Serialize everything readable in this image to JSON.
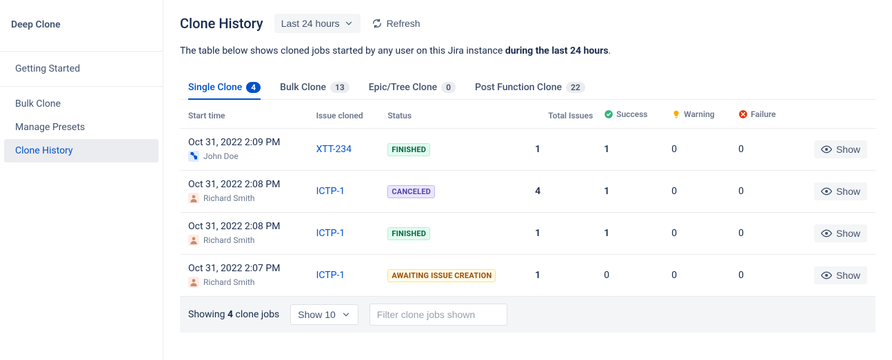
{
  "sidebar": {
    "title": "Deep Clone",
    "sections": [
      {
        "items": [
          {
            "label": "Getting Started"
          }
        ]
      },
      {
        "items": [
          {
            "label": "Bulk Clone"
          },
          {
            "label": "Manage Presets"
          },
          {
            "label": "Clone History",
            "active": true
          }
        ]
      }
    ]
  },
  "header": {
    "title": "Clone History",
    "timeRangeLabel": "Last 24 hours",
    "refreshLabel": "Refresh"
  },
  "description": {
    "prefix": "The table below shows cloned jobs started by any user on this Jira instance ",
    "bold": "during the last 24 hours",
    "suffix": "."
  },
  "tabs": [
    {
      "label": "Single Clone",
      "count": "4",
      "active": true
    },
    {
      "label": "Bulk Clone",
      "count": "13"
    },
    {
      "label": "Epic/Tree Clone",
      "count": "0"
    },
    {
      "label": "Post Function Clone",
      "count": "22"
    }
  ],
  "columns": {
    "startTime": "Start time",
    "issueCloned": "Issue cloned",
    "status": "Status",
    "totalIssues": "Total Issues",
    "success": "Success",
    "warning": "Warning",
    "failure": "Failure"
  },
  "rows": [
    {
      "time": "Oct 31, 2022 2:09 PM",
      "user": "John Doe",
      "userIcon": "puzzle",
      "issue": "XTT-234",
      "status": "FINISHED",
      "statusClass": "status-finished",
      "total": "1",
      "success": "1",
      "warning": "0",
      "failure": "0",
      "showLabel": "Show"
    },
    {
      "time": "Oct 31, 2022 2:08 PM",
      "user": "Richard Smith",
      "userIcon": "person",
      "issue": "ICTP-1",
      "status": "CANCELED",
      "statusClass": "status-canceled",
      "total": "4",
      "success": "1",
      "warning": "0",
      "failure": "0",
      "showLabel": "Show"
    },
    {
      "time": "Oct 31, 2022 2:08 PM",
      "user": "Richard Smith",
      "userIcon": "person",
      "issue": "ICTP-1",
      "status": "FINISHED",
      "statusClass": "status-finished",
      "total": "1",
      "success": "1",
      "warning": "0",
      "failure": "0",
      "showLabel": "Show"
    },
    {
      "time": "Oct 31, 2022 2:07 PM",
      "user": "Richard Smith",
      "userIcon": "person",
      "issue": "ICTP-1",
      "status": "AWAITING ISSUE CREATION",
      "statusClass": "status-awaiting",
      "total": "1",
      "success": "0",
      "warning": "0",
      "failure": "0",
      "showLabel": "Show"
    }
  ],
  "footer": {
    "showingPrefix": "Showing ",
    "showingCount": "4",
    "showingSuffix": " clone jobs",
    "pageSizeLabel": "Show 10",
    "filterPlaceholder": "Filter clone jobs shown"
  }
}
